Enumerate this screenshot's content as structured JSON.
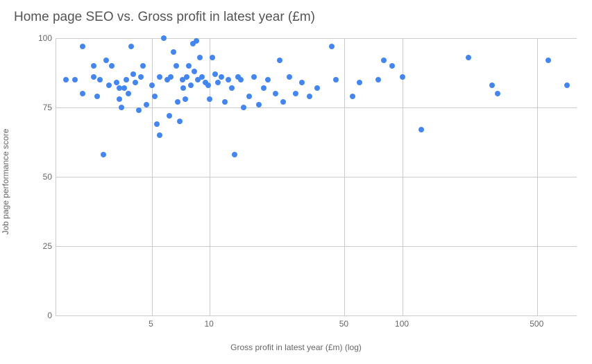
{
  "chart_data": {
    "type": "scatter",
    "title": "Home page SEO vs. Gross profit in latest year (£m)",
    "xlabel": "Gross profit in latest year (£m) (log)",
    "ylabel": "Job page performance score",
    "ylim": [
      0,
      100
    ],
    "xticks": [
      5,
      10,
      50,
      100,
      500
    ],
    "yticks": [
      0,
      25,
      50,
      75,
      100
    ],
    "x_scale": "log",
    "points": [
      {
        "x": 1.8,
        "y": 85
      },
      {
        "x": 2.0,
        "y": 85
      },
      {
        "x": 2.2,
        "y": 80
      },
      {
        "x": 2.2,
        "y": 97
      },
      {
        "x": 2.5,
        "y": 86
      },
      {
        "x": 2.5,
        "y": 90
      },
      {
        "x": 2.6,
        "y": 79
      },
      {
        "x": 2.7,
        "y": 85
      },
      {
        "x": 2.8,
        "y": 58
      },
      {
        "x": 2.9,
        "y": 92
      },
      {
        "x": 3.0,
        "y": 83
      },
      {
        "x": 3.1,
        "y": 90
      },
      {
        "x": 3.3,
        "y": 84
      },
      {
        "x": 3.4,
        "y": 82
      },
      {
        "x": 3.4,
        "y": 78
      },
      {
        "x": 3.5,
        "y": 75
      },
      {
        "x": 3.6,
        "y": 82
      },
      {
        "x": 3.7,
        "y": 85
      },
      {
        "x": 3.8,
        "y": 80
      },
      {
        "x": 3.9,
        "y": 97
      },
      {
        "x": 4.0,
        "y": 87
      },
      {
        "x": 4.1,
        "y": 84
      },
      {
        "x": 4.3,
        "y": 74
      },
      {
        "x": 4.4,
        "y": 86
      },
      {
        "x": 4.5,
        "y": 90
      },
      {
        "x": 4.7,
        "y": 76
      },
      {
        "x": 5.0,
        "y": 83
      },
      {
        "x": 5.2,
        "y": 79
      },
      {
        "x": 5.3,
        "y": 69
      },
      {
        "x": 5.5,
        "y": 65
      },
      {
        "x": 5.5,
        "y": 86
      },
      {
        "x": 5.8,
        "y": 100
      },
      {
        "x": 6.0,
        "y": 85
      },
      {
        "x": 6.2,
        "y": 72
      },
      {
        "x": 6.3,
        "y": 86
      },
      {
        "x": 6.5,
        "y": 95
      },
      {
        "x": 6.7,
        "y": 90
      },
      {
        "x": 6.8,
        "y": 77
      },
      {
        "x": 7.0,
        "y": 70
      },
      {
        "x": 7.2,
        "y": 85
      },
      {
        "x": 7.3,
        "y": 82
      },
      {
        "x": 7.5,
        "y": 78
      },
      {
        "x": 7.6,
        "y": 86
      },
      {
        "x": 7.8,
        "y": 90
      },
      {
        "x": 8.0,
        "y": 83
      },
      {
        "x": 8.2,
        "y": 98
      },
      {
        "x": 8.3,
        "y": 88
      },
      {
        "x": 8.5,
        "y": 99
      },
      {
        "x": 8.7,
        "y": 85
      },
      {
        "x": 8.9,
        "y": 93
      },
      {
        "x": 9.1,
        "y": 86
      },
      {
        "x": 9.5,
        "y": 84
      },
      {
        "x": 9.8,
        "y": 83
      },
      {
        "x": 10.0,
        "y": 78
      },
      {
        "x": 10.3,
        "y": 93
      },
      {
        "x": 10.7,
        "y": 87
      },
      {
        "x": 11.0,
        "y": 84
      },
      {
        "x": 11.5,
        "y": 86
      },
      {
        "x": 12.0,
        "y": 77
      },
      {
        "x": 12.5,
        "y": 85
      },
      {
        "x": 13.0,
        "y": 82
      },
      {
        "x": 13.5,
        "y": 58
      },
      {
        "x": 14.0,
        "y": 86
      },
      {
        "x": 14.5,
        "y": 85
      },
      {
        "x": 15.0,
        "y": 75
      },
      {
        "x": 16.0,
        "y": 79
      },
      {
        "x": 17.0,
        "y": 86
      },
      {
        "x": 18.0,
        "y": 76
      },
      {
        "x": 19.0,
        "y": 82
      },
      {
        "x": 20.0,
        "y": 85
      },
      {
        "x": 22.0,
        "y": 80
      },
      {
        "x": 23.0,
        "y": 92
      },
      {
        "x": 24.0,
        "y": 77
      },
      {
        "x": 26.0,
        "y": 86
      },
      {
        "x": 28.0,
        "y": 80
      },
      {
        "x": 30.0,
        "y": 84
      },
      {
        "x": 33.0,
        "y": 79
      },
      {
        "x": 36.0,
        "y": 82
      },
      {
        "x": 43.0,
        "y": 97
      },
      {
        "x": 45.0,
        "y": 85
      },
      {
        "x": 55.0,
        "y": 79
      },
      {
        "x": 60.0,
        "y": 84
      },
      {
        "x": 75.0,
        "y": 85
      },
      {
        "x": 80.0,
        "y": 92
      },
      {
        "x": 88.0,
        "y": 90
      },
      {
        "x": 100.0,
        "y": 86
      },
      {
        "x": 125.0,
        "y": 67
      },
      {
        "x": 220.0,
        "y": 93
      },
      {
        "x": 290.0,
        "y": 83
      },
      {
        "x": 310.0,
        "y": 80
      },
      {
        "x": 570.0,
        "y": 92
      },
      {
        "x": 710.0,
        "y": 83
      }
    ]
  }
}
